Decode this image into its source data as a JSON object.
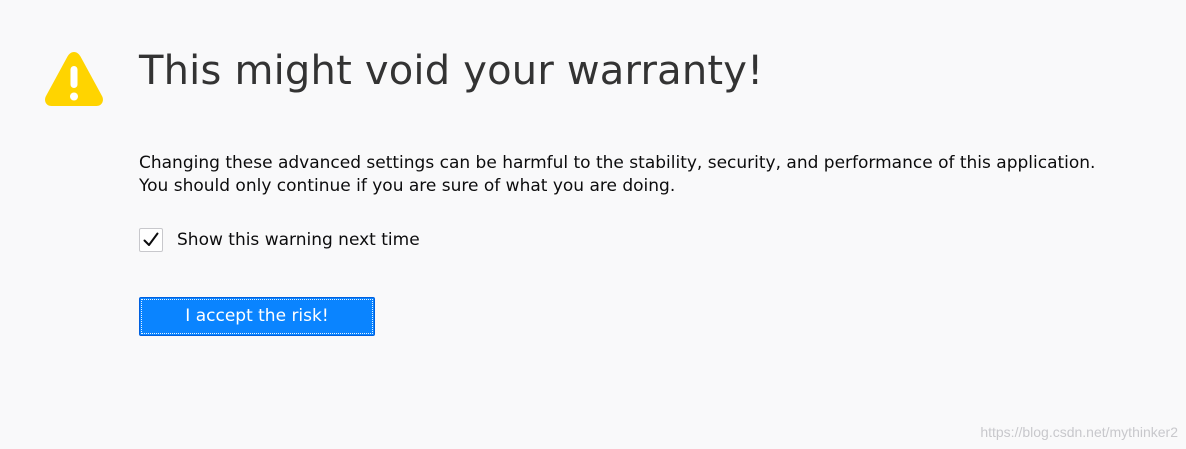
{
  "page": {
    "title": "This might void your warranty!",
    "description_line1": "Changing these advanced settings can be harmful to the stability, security, and performance of this application.",
    "description_line2": "You should only continue if you are sure of what you are doing."
  },
  "warning_checkbox": {
    "label": "Show this warning next time",
    "checked": true
  },
  "accept_button": {
    "label": "I accept the risk!"
  },
  "watermark": {
    "text": "https://blog.csdn.net/mythinker2"
  },
  "icons": {
    "warning": "warning-triangle-icon",
    "check": "checkmark-icon"
  },
  "colors": {
    "warning_icon": "#ffd400",
    "button_bg": "#0a84ff",
    "page_bg": "#f9f9fa"
  }
}
